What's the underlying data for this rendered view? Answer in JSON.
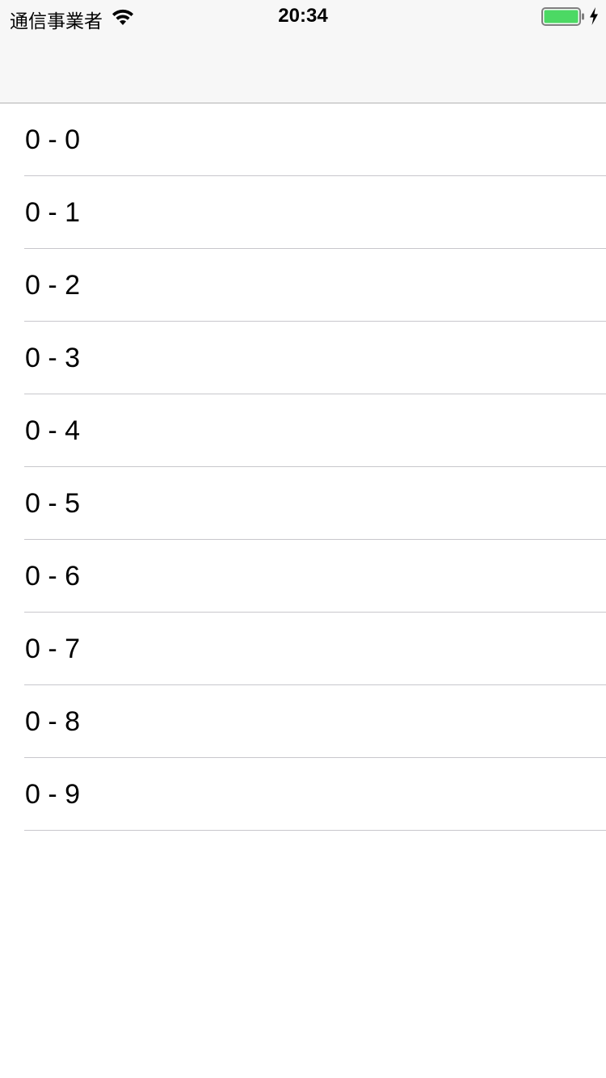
{
  "status_bar": {
    "carrier": "通信事業者",
    "time": "20:34",
    "wifi_icon": "wifi-icon",
    "battery_icon": "battery-icon",
    "charging_icon": "charging-bolt-icon",
    "battery_color": "#4cd964",
    "battery_level": 1.0
  },
  "nav_bar": {
    "title": ""
  },
  "rows": [
    {
      "label": "0 - 0"
    },
    {
      "label": "0 - 1"
    },
    {
      "label": "0 - 2"
    },
    {
      "label": "0 - 3"
    },
    {
      "label": "0 - 4"
    },
    {
      "label": "0 - 5"
    },
    {
      "label": "0 - 6"
    },
    {
      "label": "0 - 7"
    },
    {
      "label": "0 - 8"
    },
    {
      "label": "0 - 9"
    }
  ]
}
